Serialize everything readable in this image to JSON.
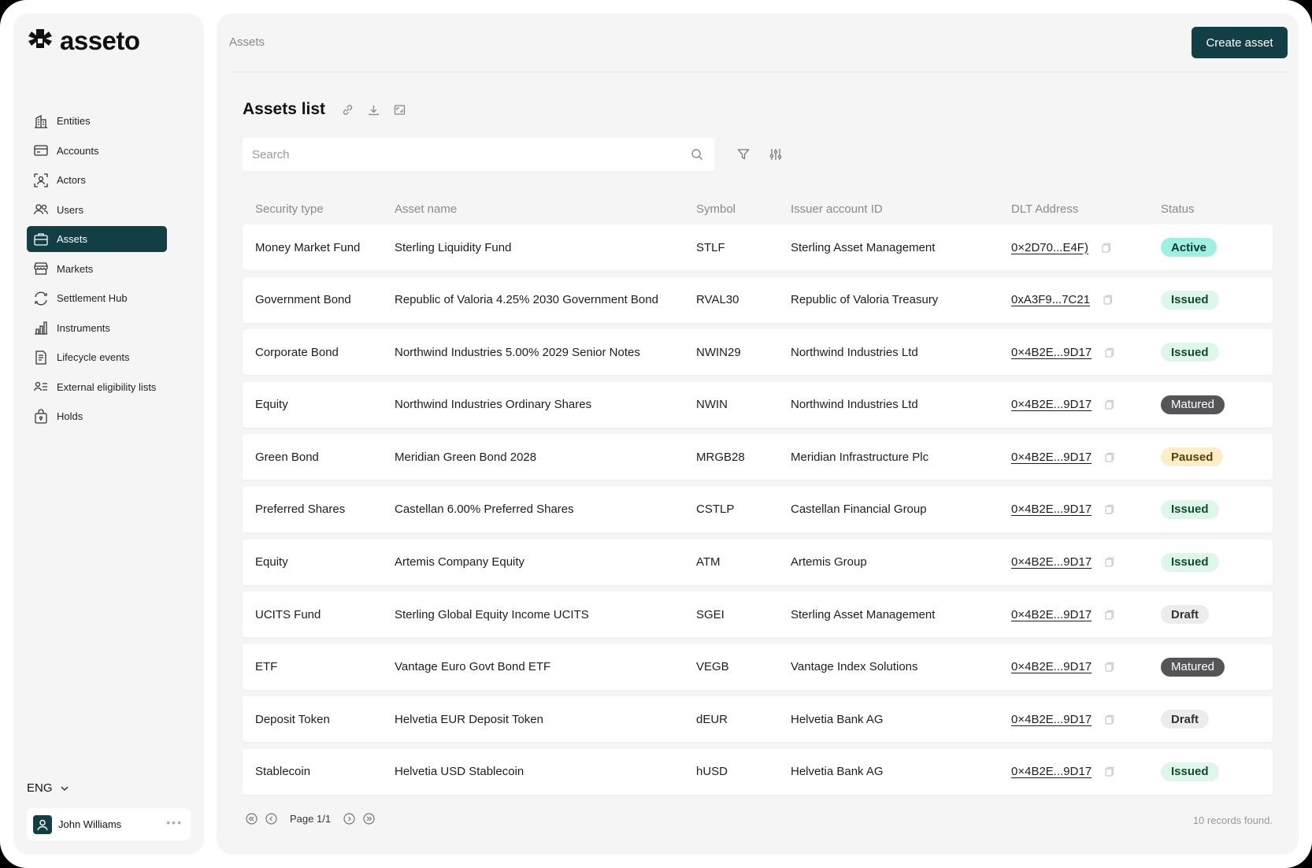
{
  "app": {
    "name": "asseto"
  },
  "sidebar": {
    "items": [
      {
        "label": "Entities",
        "icon": "building-icon"
      },
      {
        "label": "Accounts",
        "icon": "wallet-icon"
      },
      {
        "label": "Actors",
        "icon": "actor-icon"
      },
      {
        "label": "Users",
        "icon": "users-icon"
      },
      {
        "label": "Assets",
        "icon": "briefcase-icon",
        "active": true
      },
      {
        "label": "Markets",
        "icon": "store-icon"
      },
      {
        "label": "Settlement Hub",
        "icon": "refresh-icon"
      },
      {
        "label": "Instruments",
        "icon": "bar-chart-icon"
      },
      {
        "label": "Lifecycle events",
        "icon": "document-icon"
      },
      {
        "label": "External eligibility lists",
        "icon": "user-list-icon"
      },
      {
        "label": "Holds",
        "icon": "lock-bag-icon"
      }
    ],
    "language": "ENG",
    "user": {
      "name": "John Williams"
    }
  },
  "header": {
    "breadcrumb": "Assets",
    "create_label": "Create asset"
  },
  "page": {
    "title": "Assets list",
    "search_placeholder": "Search"
  },
  "table": {
    "columns": [
      "Security type",
      "Asset name",
      "Symbol",
      "Issuer account ID",
      "DLT Address",
      "Status"
    ],
    "rows": [
      {
        "type": "Money Market Fund",
        "name": "Sterling Liquidity Fund",
        "symbol": "STLF",
        "issuer": "Sterling Asset Management",
        "address": "0×2D70...E4F)",
        "status": "Active",
        "status_kind": "active"
      },
      {
        "type": "Government Bond",
        "name": "Republic of Valoria 4.25% 2030 Government Bond",
        "symbol": "RVAL30",
        "issuer": "Republic of Valoria Treasury",
        "address": "0xA3F9...7C21",
        "status": "Issued",
        "status_kind": "issued"
      },
      {
        "type": "Corporate Bond",
        "name": "Northwind Industries 5.00% 2029 Senior Notes",
        "symbol": "NWIN29",
        "issuer": "Northwind Industries Ltd",
        "address": "0×4B2E...9D17",
        "status": "Issued",
        "status_kind": "issued"
      },
      {
        "type": "Equity",
        "name": "Northwind Industries Ordinary Shares",
        "symbol": "NWIN",
        "issuer": "Northwind Industries Ltd",
        "address": "0×4B2E...9D17",
        "status": "Matured",
        "status_kind": "matured"
      },
      {
        "type": "Green Bond",
        "name": "Meridian Green Bond 2028",
        "symbol": "MRGB28",
        "issuer": "Meridian Infrastructure Plc",
        "address": "0×4B2E...9D17",
        "status": "Paused",
        "status_kind": "paused"
      },
      {
        "type": "Preferred Shares",
        "name": "Castellan 6.00% Preferred Shares",
        "symbol": "CSTLP",
        "issuer": "Castellan Financial Group",
        "address": "0×4B2E...9D17",
        "status": "Issued",
        "status_kind": "issued"
      },
      {
        "type": "Equity",
        "name": "Artemis Company Equity",
        "symbol": "ATM",
        "issuer": "Artemis Group",
        "address": "0×4B2E...9D17",
        "status": "Issued",
        "status_kind": "issued"
      },
      {
        "type": "UCITS Fund",
        "name": "Sterling Global Equity Income UCITS",
        "symbol": "SGEI",
        "issuer": "Sterling Asset Management",
        "address": "0×4B2E...9D17",
        "status": "Draft",
        "status_kind": "draft"
      },
      {
        "type": "ETF",
        "name": "Vantage Euro Govt Bond ETF",
        "symbol": "VEGB",
        "issuer": "Vantage Index Solutions",
        "address": "0×4B2E...9D17",
        "status": "Matured",
        "status_kind": "matured"
      },
      {
        "type": "Deposit Token",
        "name": "Helvetia EUR Deposit Token",
        "symbol": "dEUR",
        "issuer": "Helvetia Bank AG",
        "address": "0×4B2E...9D17",
        "status": "Draft",
        "status_kind": "draft"
      },
      {
        "type": "Stablecoin",
        "name": "Helvetia USD Stablecoin",
        "symbol": "hUSD",
        "issuer": "Helvetia Bank AG",
        "address": "0×4B2E...9D17",
        "status": "Issued",
        "status_kind": "issued"
      }
    ]
  },
  "pagination": {
    "label": "Page 1/1",
    "records": "10 records found."
  },
  "colors": {
    "brand": "#123f45",
    "active_badge": "#9ff0e0",
    "issued_badge": "#dff7ea",
    "matured_badge": "#555557",
    "paused_badge": "#fdedc8",
    "draft_badge": "#ececec"
  }
}
